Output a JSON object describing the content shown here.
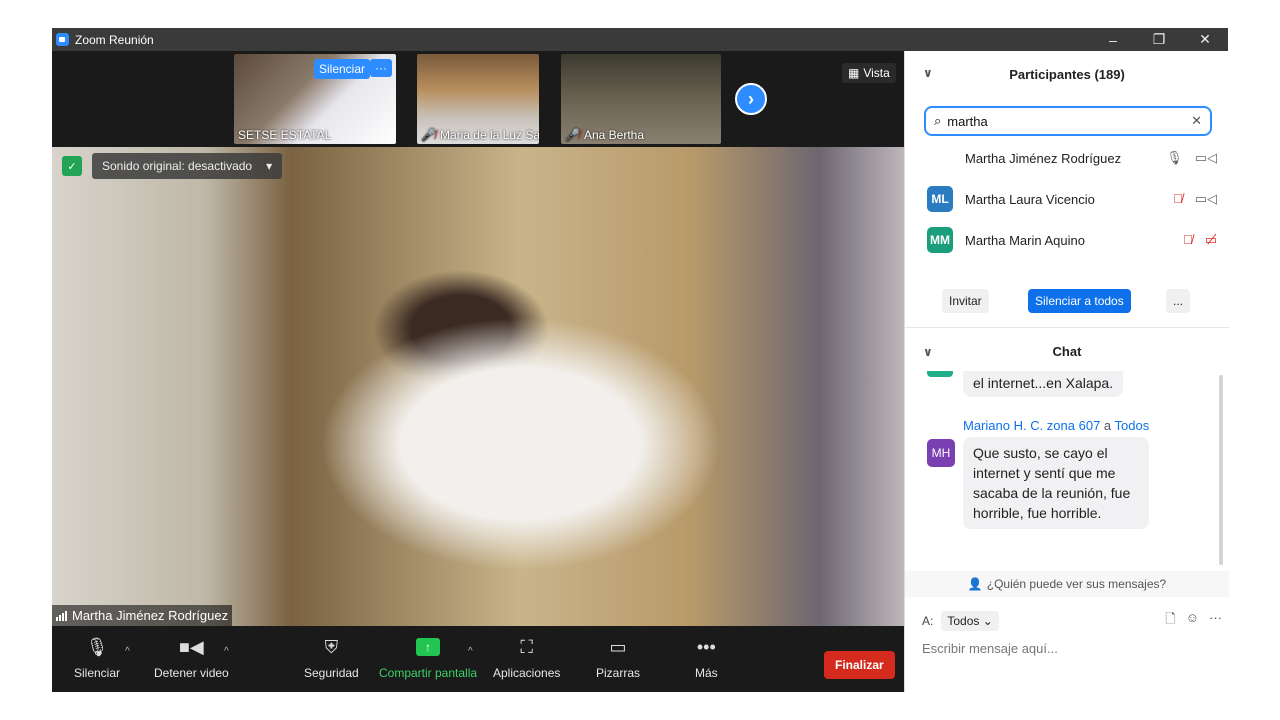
{
  "window": {
    "title": "Zoom Reunión",
    "controls": [
      "–",
      "❐",
      "✕"
    ]
  },
  "strip": {
    "thumbs": [
      {
        "name": "SETSE ESTATAL"
      },
      {
        "name": "Maria de la Luz Santi..."
      },
      {
        "name": "Ana Bertha"
      }
    ],
    "silenciar_label": "Silenciar",
    "more_label": "···",
    "next_label": "›",
    "vista_label": "Vista"
  },
  "main_video": {
    "sound_label": "Sonido original: desactivado",
    "sound_caret": "▾",
    "speaker_name": "Martha Jiménez Rodríguez"
  },
  "toolbar": {
    "silenciar": "Silenciar",
    "detener_video": "Detener video",
    "seguridad": "Seguridad",
    "compartir": "Compartir pantalla",
    "aplicaciones": "Aplicaciones",
    "pizarras": "Pizarras",
    "mas": "Más",
    "finalizar": "Finalizar"
  },
  "participants": {
    "header": "Participantes (189)",
    "search_value": "martha",
    "rows": [
      {
        "initials": "",
        "name": "Martha Jiménez Rodríguez",
        "color": "transparent",
        "mic_muted": false,
        "video_off": false
      },
      {
        "initials": "ML",
        "name": "Martha Laura Vicencio",
        "color": "#2b7bc0",
        "mic_muted": true,
        "video_off": false
      },
      {
        "initials": "MM",
        "name": "Martha Marin Aquino",
        "color": "#1a9e7c",
        "mic_muted": true,
        "video_off": true
      }
    ],
    "invitar": "Invitar",
    "silenciar_todos": "Silenciar a todos",
    "more": "..."
  },
  "chat": {
    "header": "Chat",
    "prev_message": "el internet...en Xalapa.",
    "sender": "Mariano H. C. zona 607",
    "to_word": "a",
    "recipient": "Todos",
    "sender_initials": "MH",
    "message": "Que susto, se cayo el internet y sentí que me sacaba de la reunión, fue horrible, fue horrible.",
    "who_can_see": "¿Quién puede ver sus mensajes?",
    "to_label": "A:",
    "to_value": "Todos",
    "placeholder": "Escribir mensaje aquí..."
  }
}
